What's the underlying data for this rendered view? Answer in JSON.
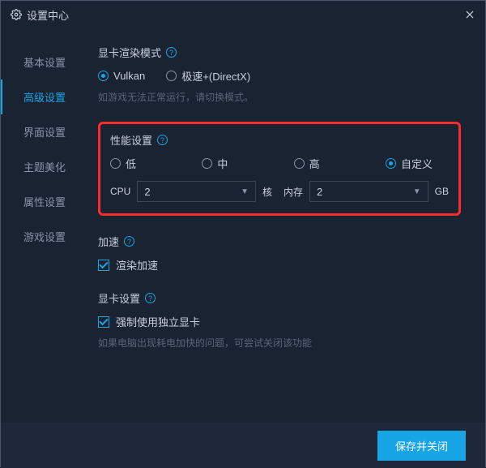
{
  "titlebar": {
    "title": "设置中心"
  },
  "sidebar": {
    "items": [
      {
        "label": "基本设置"
      },
      {
        "label": "高级设置"
      },
      {
        "label": "界面设置"
      },
      {
        "label": "主题美化"
      },
      {
        "label": "属性设置"
      },
      {
        "label": "游戏设置"
      }
    ]
  },
  "render": {
    "title": "显卡渲染模式",
    "options": [
      {
        "label": "Vulkan",
        "checked": true
      },
      {
        "label": "极速+(DirectX)",
        "checked": false
      }
    ],
    "hint": "如游戏无法正常运行，请切换模式。"
  },
  "perf": {
    "title": "性能设置",
    "options": [
      {
        "label": "低",
        "checked": false
      },
      {
        "label": "中",
        "checked": false
      },
      {
        "label": "高",
        "checked": false
      },
      {
        "label": "自定义",
        "checked": true
      }
    ],
    "cpu_label": "CPU",
    "cpu_value": "2",
    "cpu_unit": "核",
    "mem_label": "内存",
    "mem_value": "2",
    "mem_unit": "GB"
  },
  "accel": {
    "title": "加速",
    "checkbox_label": "渲染加速",
    "checked": true
  },
  "gpu": {
    "title": "显卡设置",
    "checkbox_label": "强制使用独立显卡",
    "checked": true,
    "hint": "如果电脑出现耗电加快的问题，可尝试关闭该功能"
  },
  "footer": {
    "save_label": "保存并关闭"
  }
}
